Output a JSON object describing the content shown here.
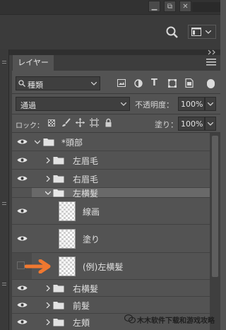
{
  "panel": {
    "tab_label": "レイヤー",
    "filter_value": "種類",
    "blend_mode": "通過",
    "opacity_label": "不透明度：",
    "opacity_value": "100%",
    "lock_label": "ロック：",
    "fill_label": "塗り：",
    "fill_value": "100%"
  },
  "layers": [
    {
      "name": "*頭部",
      "type": "group",
      "expanded": true,
      "visible": true,
      "selected": false
    },
    {
      "name": "左眉毛",
      "type": "group",
      "expanded": false,
      "visible": true,
      "selected": false
    },
    {
      "name": "右眉毛",
      "type": "group",
      "expanded": false,
      "visible": true,
      "selected": false
    },
    {
      "name": "左横髮",
      "type": "group",
      "expanded": true,
      "visible": true,
      "selected": true
    },
    {
      "name": "線画",
      "type": "layer",
      "visible": true,
      "selected": false
    },
    {
      "name": "塗り",
      "type": "layer",
      "visible": true,
      "selected": false
    },
    {
      "name": "(例)左横髮",
      "type": "layer",
      "visible": false,
      "selected": false
    },
    {
      "name": "右横髮",
      "type": "group",
      "expanded": false,
      "visible": true,
      "selected": false
    },
    {
      "name": "前髮",
      "type": "group",
      "expanded": false,
      "visible": true,
      "selected": false
    },
    {
      "name": "左頬",
      "type": "group",
      "expanded": false,
      "visible": true,
      "selected": false
    }
  ],
  "watermark": "木木软件下载和游戏攻略",
  "colors": {
    "arrow": "#f07830",
    "selected_row": "#696969",
    "panel_bg": "#535353"
  },
  "icons": [
    "minimize-icon",
    "restore-icon",
    "close-icon",
    "search-icon",
    "workspace-icon",
    "panel-menu-icon",
    "eye-icon",
    "folder-icon",
    "chevron-icon",
    "lock-icon",
    "brush-icon",
    "move-icon",
    "artboard-icon",
    "filter-image-icon",
    "filter-adjustment-icon",
    "filter-text-icon",
    "filter-shape-icon",
    "filter-smart-icon"
  ]
}
